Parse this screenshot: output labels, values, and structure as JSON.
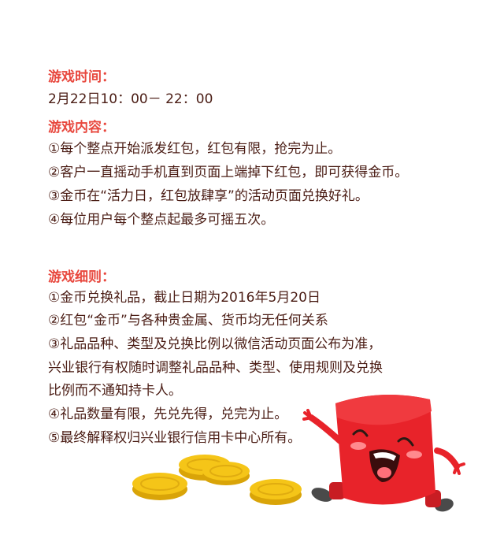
{
  "time_section": {
    "heading": "游戏时间：",
    "value": "2月22日10：00－ 22：00"
  },
  "content_section": {
    "heading": "游戏内容：",
    "items": [
      "①每个整点开始派发红包，红包有限，抢完为止。",
      "②客户一直摇动手机直到页面上端掉下红包，即可获得金币。",
      "③金币在“活力日，红包放肆享”的活动页面兑换好礼。",
      "④每位用户每个整点起最多可摇五次。"
    ]
  },
  "rules_section": {
    "heading": "游戏细则：",
    "lines": [
      "①金币兑换礼品，截止日期为2016年5月20日",
      "②红包“金币”与各种贵金属、货币均无任何关系",
      "③礼品品种、类型及兑换比例以微信活动页面公布为准，",
      "兴业银行有权随时调整礼品品种、类型、使用规则及兑换",
      "比例而不通知持卡人。",
      "④礼品数量有限，先兑先得，兑完为止。",
      "⑤最终解释权归兴业银行信用卡中心所有。"
    ]
  },
  "colors": {
    "heading": "#e8483e",
    "body_text": "#4a1c14",
    "coin": "#f5c518",
    "mascot_red": "#e8232a"
  }
}
